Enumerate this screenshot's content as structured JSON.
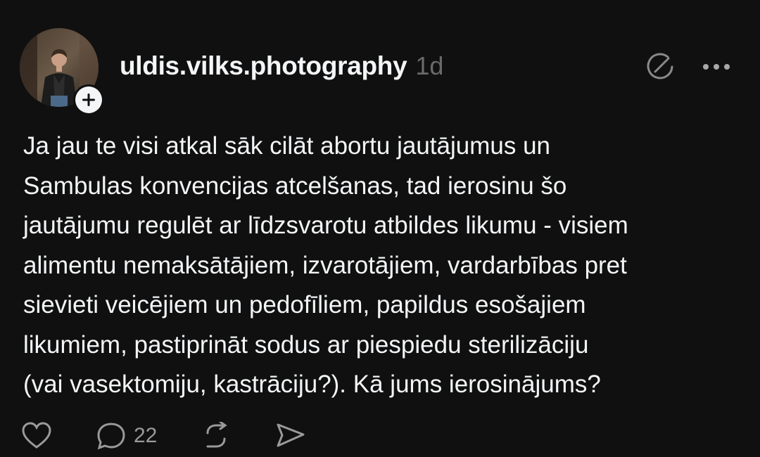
{
  "post": {
    "author": {
      "username": "uldis.vilks.photography",
      "avatar_icon": "profile-photo",
      "follow_icon": "plus-icon"
    },
    "timestamp": "1d",
    "header_icons": [
      "activity-icon",
      "more-options-icon"
    ],
    "text_lines": [
      "Ja jau te visi atkal sāk cilāt abortu jautājumus un",
      "Sambulas konvencijas atcelšanas, tad ierosinu šo",
      "jautājumu regulēt ar līdzsvarotu atbildes likumu - visiem",
      "alimentu nemaksātājiem, izvarotājiem, vardarbības pret",
      "sievieti veicējiem un pedofīliem, papildus esošajiem",
      "likumiem, pastiprināt sodus ar piespiedu sterilizāciju",
      "(vai vasektomiju, kastrāciju?). Kā jums ierosinājums?"
    ],
    "actions": {
      "like_icon": "heart-icon",
      "comment_icon": "comment-icon",
      "comment_count": "22",
      "repost_icon": "repost-icon",
      "share_icon": "share-icon"
    }
  },
  "colors": {
    "background": "#101010",
    "text_primary": "#f3f5f7",
    "text_secondary": "#6a6a6a",
    "icon": "#8a8a8a"
  }
}
